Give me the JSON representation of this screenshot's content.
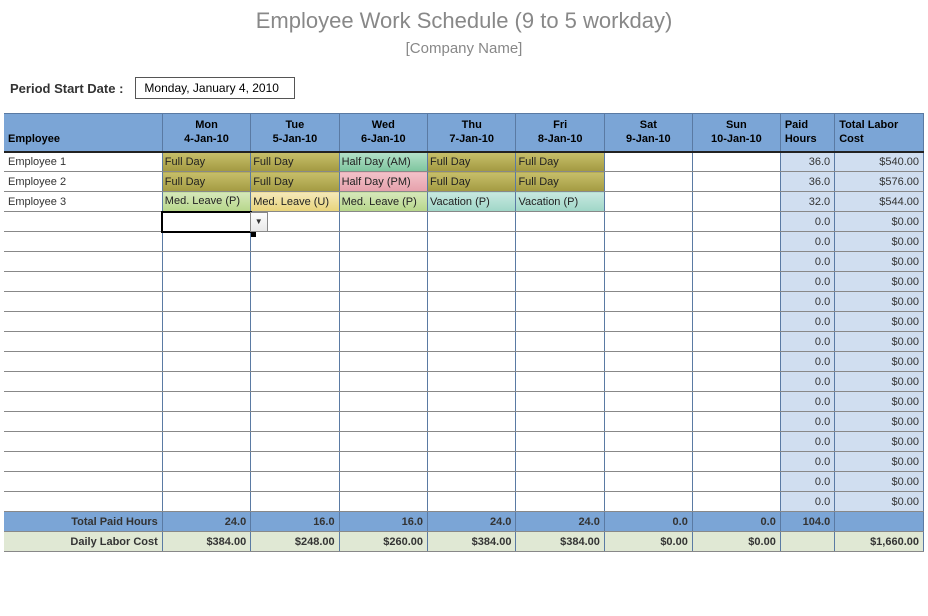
{
  "header": {
    "title": "Employee Work Schedule (9 to 5  workday)",
    "subtitle": "[Company Name]"
  },
  "period": {
    "label": "Period Start Date :",
    "value": "Monday, January 4, 2010"
  },
  "columns": {
    "employee": "Employee",
    "days": [
      {
        "dow": "Mon",
        "date": "4-Jan-10"
      },
      {
        "dow": "Tue",
        "date": "5-Jan-10"
      },
      {
        "dow": "Wed",
        "date": "6-Jan-10"
      },
      {
        "dow": "Thu",
        "date": "7-Jan-10"
      },
      {
        "dow": "Fri",
        "date": "8-Jan-10"
      },
      {
        "dow": "Sat",
        "date": "9-Jan-10"
      },
      {
        "dow": "Sun",
        "date": "10-Jan-10"
      }
    ],
    "paid_hours": "Paid Hours",
    "labor_cost": "Total Labor Cost"
  },
  "rows": [
    {
      "employee": "Employee 1",
      "days": [
        "Full Day",
        "Full Day",
        "Half Day (AM)",
        "Full Day",
        "Full Day",
        "",
        ""
      ],
      "styles": [
        "full-day",
        "full-day",
        "half-am",
        "full-day",
        "full-day",
        "",
        ""
      ],
      "paid": "36.0",
      "cost": "$540.00"
    },
    {
      "employee": "Employee 2",
      "days": [
        "Full Day",
        "Full Day",
        "Half Day (PM)",
        "Full Day",
        "Full Day",
        "",
        ""
      ],
      "styles": [
        "full-day",
        "full-day",
        "half-pm",
        "full-day",
        "full-day",
        "",
        ""
      ],
      "paid": "36.0",
      "cost": "$576.00"
    },
    {
      "employee": "Employee 3",
      "days": [
        "Med. Leave (P)",
        "Med. Leave (U)",
        "Med. Leave (P)",
        "Vacation (P)",
        "Vacation (P)",
        "",
        ""
      ],
      "styles": [
        "med-p",
        "med-u",
        "med-p",
        "vac-p",
        "vac-p",
        "",
        ""
      ],
      "paid": "32.0",
      "cost": "$544.00"
    },
    {
      "employee": "",
      "days": [
        "",
        "",
        "",
        "",
        "",
        "",
        ""
      ],
      "styles": [
        "",
        "",
        "",
        "",
        "",
        "",
        ""
      ],
      "paid": "0.0",
      "cost": "$0.00",
      "selected": true
    },
    {
      "employee": "",
      "days": [
        "",
        "",
        "",
        "",
        "",
        "",
        ""
      ],
      "styles": [
        "",
        "",
        "",
        "",
        "",
        "",
        ""
      ],
      "paid": "0.0",
      "cost": "$0.00"
    },
    {
      "employee": "",
      "days": [
        "",
        "",
        "",
        "",
        "",
        "",
        ""
      ],
      "styles": [
        "",
        "",
        "",
        "",
        "",
        "",
        ""
      ],
      "paid": "0.0",
      "cost": "$0.00"
    },
    {
      "employee": "",
      "days": [
        "",
        "",
        "",
        "",
        "",
        "",
        ""
      ],
      "styles": [
        "",
        "",
        "",
        "",
        "",
        "",
        ""
      ],
      "paid": "0.0",
      "cost": "$0.00"
    },
    {
      "employee": "",
      "days": [
        "",
        "",
        "",
        "",
        "",
        "",
        ""
      ],
      "styles": [
        "",
        "",
        "",
        "",
        "",
        "",
        ""
      ],
      "paid": "0.0",
      "cost": "$0.00"
    },
    {
      "employee": "",
      "days": [
        "",
        "",
        "",
        "",
        "",
        "",
        ""
      ],
      "styles": [
        "",
        "",
        "",
        "",
        "",
        "",
        ""
      ],
      "paid": "0.0",
      "cost": "$0.00"
    },
    {
      "employee": "",
      "days": [
        "",
        "",
        "",
        "",
        "",
        "",
        ""
      ],
      "styles": [
        "",
        "",
        "",
        "",
        "",
        "",
        ""
      ],
      "paid": "0.0",
      "cost": "$0.00"
    },
    {
      "employee": "",
      "days": [
        "",
        "",
        "",
        "",
        "",
        "",
        ""
      ],
      "styles": [
        "",
        "",
        "",
        "",
        "",
        "",
        ""
      ],
      "paid": "0.0",
      "cost": "$0.00"
    },
    {
      "employee": "",
      "days": [
        "",
        "",
        "",
        "",
        "",
        "",
        ""
      ],
      "styles": [
        "",
        "",
        "",
        "",
        "",
        "",
        ""
      ],
      "paid": "0.0",
      "cost": "$0.00"
    },
    {
      "employee": "",
      "days": [
        "",
        "",
        "",
        "",
        "",
        "",
        ""
      ],
      "styles": [
        "",
        "",
        "",
        "",
        "",
        "",
        ""
      ],
      "paid": "0.0",
      "cost": "$0.00"
    },
    {
      "employee": "",
      "days": [
        "",
        "",
        "",
        "",
        "",
        "",
        ""
      ],
      "styles": [
        "",
        "",
        "",
        "",
        "",
        "",
        ""
      ],
      "paid": "0.0",
      "cost": "$0.00"
    },
    {
      "employee": "",
      "days": [
        "",
        "",
        "",
        "",
        "",
        "",
        ""
      ],
      "styles": [
        "",
        "",
        "",
        "",
        "",
        "",
        ""
      ],
      "paid": "0.0",
      "cost": "$0.00"
    },
    {
      "employee": "",
      "days": [
        "",
        "",
        "",
        "",
        "",
        "",
        ""
      ],
      "styles": [
        "",
        "",
        "",
        "",
        "",
        "",
        ""
      ],
      "paid": "0.0",
      "cost": "$0.00"
    },
    {
      "employee": "",
      "days": [
        "",
        "",
        "",
        "",
        "",
        "",
        ""
      ],
      "styles": [
        "",
        "",
        "",
        "",
        "",
        "",
        ""
      ],
      "paid": "0.0",
      "cost": "$0.00"
    },
    {
      "employee": "",
      "days": [
        "",
        "",
        "",
        "",
        "",
        "",
        ""
      ],
      "styles": [
        "",
        "",
        "",
        "",
        "",
        "",
        ""
      ],
      "paid": "0.0",
      "cost": "$0.00"
    }
  ],
  "totals": {
    "label": "Total Paid Hours",
    "days": [
      "24.0",
      "16.0",
      "16.0",
      "24.0",
      "24.0",
      "0.0",
      "0.0"
    ],
    "paid": "104.0",
    "cost": ""
  },
  "daily_cost": {
    "label": "Daily Labor Cost",
    "days": [
      "$384.00",
      "$248.00",
      "$260.00",
      "$384.00",
      "$384.00",
      "$0.00",
      "$0.00"
    ],
    "paid": "",
    "cost": "$1,660.00"
  }
}
